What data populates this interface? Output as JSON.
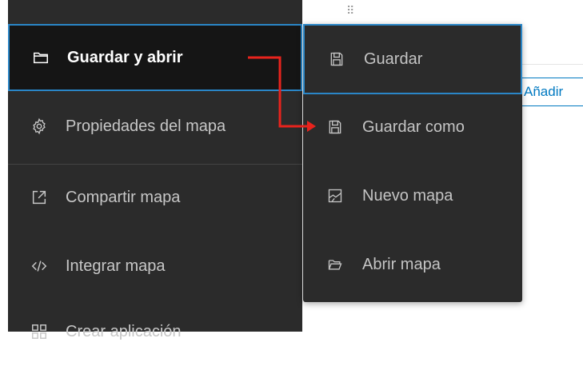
{
  "left_menu": {
    "items": [
      {
        "label": "Guardar y abrir",
        "icon": "folder-icon",
        "active": true
      },
      {
        "label": "Propiedades del mapa",
        "icon": "gear-icon",
        "active": false
      },
      {
        "label": "Compartir mapa",
        "icon": "share-icon",
        "active": false
      },
      {
        "label": "Integrar mapa",
        "icon": "code-icon",
        "active": false
      },
      {
        "label": "Crear aplicación",
        "icon": "apps-icon",
        "active": false
      }
    ]
  },
  "submenu": {
    "items": [
      {
        "label": "Guardar",
        "icon": "save-icon",
        "active": true
      },
      {
        "label": "Guardar como",
        "icon": "save-as-icon",
        "active": false
      },
      {
        "label": "Nuevo mapa",
        "icon": "new-map-icon",
        "active": false
      },
      {
        "label": "Abrir mapa",
        "icon": "open-folder-icon",
        "active": false
      }
    ]
  },
  "background": {
    "add_button_label": "Añadir"
  },
  "colors": {
    "panel": "#2b2b2b",
    "active_bg": "#151515",
    "highlight_border": "#2a86c7",
    "annotation": "#e8231d",
    "accent": "#0079c1"
  }
}
